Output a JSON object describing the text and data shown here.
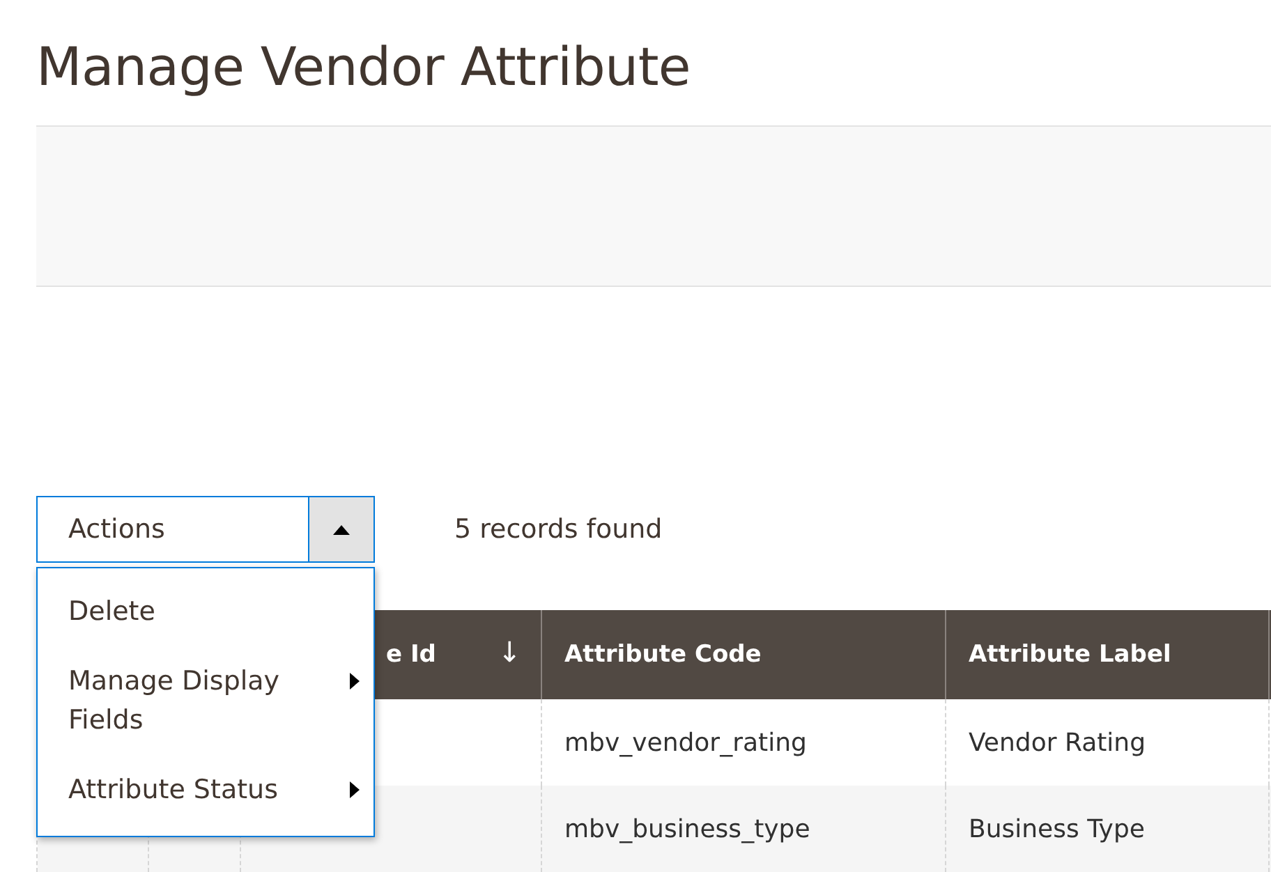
{
  "page_title": "Manage Vendor Attribute",
  "actions": {
    "label": "Actions",
    "expanded": true,
    "items": [
      {
        "label": "Delete",
        "has_submenu": false
      },
      {
        "label": "Manage Display Fields",
        "has_submenu": true
      },
      {
        "label": "Attribute Status",
        "has_submenu": true
      }
    ]
  },
  "records_count": "5 records found",
  "table": {
    "columns": [
      {},
      {},
      {
        "label": "e Id",
        "sort": "↓"
      },
      {
        "label": "Attribute Code"
      },
      {
        "label": "Attribute Label"
      },
      {}
    ],
    "rows": [
      {
        "attribute_code": "mbv_vendor_rating",
        "attribute_label": "Vendor Rating"
      },
      {
        "attribute_code": "mbv_business_type",
        "attribute_label": "Business Type"
      }
    ]
  }
}
